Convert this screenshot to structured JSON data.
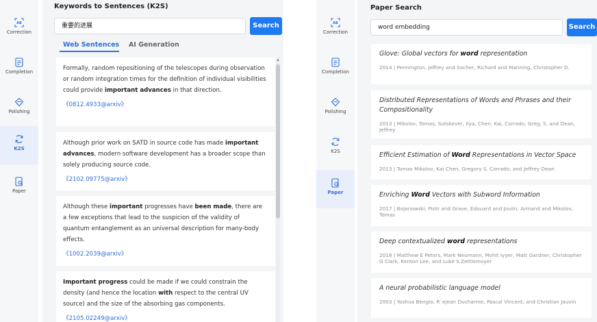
{
  "left_sidebar": {
    "items": [
      {
        "label": "Correction",
        "icon": "ab-correction-icon"
      },
      {
        "label": "Completion",
        "icon": "document-icon"
      },
      {
        "label": "Polishing",
        "icon": "diamond-icon"
      },
      {
        "label": "K2S",
        "icon": "refresh-icon"
      },
      {
        "label": "Paper",
        "icon": "paper-search-icon"
      }
    ],
    "active": "K2S"
  },
  "k2s": {
    "title": "Keywords to Sentences (K2S)",
    "search_value": "重要的进展",
    "search_button": "Search",
    "tabs": [
      "Web Sentences",
      "AI Generation"
    ],
    "active_tab": "Web Sentences",
    "results": [
      {
        "segments": [
          {
            "t": "Formally, random repositioning of the telescopes during observation or random integration times for the definition of individual visibilities could provide ",
            "b": false
          },
          {
            "t": "important advances",
            "b": true
          },
          {
            "t": " in that direction.",
            "b": false
          }
        ],
        "source": "《0812.4933@arxiv》"
      },
      {
        "segments": [
          {
            "t": "Although prior work on SATD in source code has made ",
            "b": false
          },
          {
            "t": "important advances",
            "b": true
          },
          {
            "t": ", modern software development has a broader scope than solely producing source code.",
            "b": false
          }
        ],
        "source": "《2102.09775@arxiv》"
      },
      {
        "segments": [
          {
            "t": "Although these ",
            "b": false
          },
          {
            "t": "important",
            "b": true
          },
          {
            "t": " progresses have ",
            "b": false
          },
          {
            "t": "been made",
            "b": true
          },
          {
            "t": ", there are a few exceptions that lead to the suspicion of the validity of quantum entanglement as an universal description for many-body effects.",
            "b": false
          }
        ],
        "source": "《1002.2039@arxiv》"
      },
      {
        "segments": [
          {
            "t": "Important progress",
            "b": true
          },
          {
            "t": " could be made if we could constrain the density (and hence the location ",
            "b": false
          },
          {
            "t": "with",
            "b": true
          },
          {
            "t": " respect to the central UV source) and the size of the absorbing gas components.",
            "b": false
          }
        ],
        "source": "《2105.02249@arxiv》"
      }
    ]
  },
  "right_sidebar": {
    "items": [
      {
        "label": "Correction",
        "icon": "ab-correction-icon"
      },
      {
        "label": "Completion",
        "icon": "document-icon"
      },
      {
        "label": "Polishing",
        "icon": "diamond-icon"
      },
      {
        "label": "K2S",
        "icon": "refresh-icon"
      },
      {
        "label": "Paper",
        "icon": "paper-search-icon"
      }
    ],
    "active": "Paper"
  },
  "paper_search": {
    "title": "Paper Search",
    "search_value": "word embedding",
    "search_button": "Search",
    "results": [
      {
        "title_segments": [
          {
            "t": "Glove: Global vectors for ",
            "b": false
          },
          {
            "t": "word",
            "b": true
          },
          {
            "t": " representation",
            "b": false
          }
        ],
        "meta": "2014 | Pennington, Jeffrey and Socher, Richard and Manning, Christopher D."
      },
      {
        "title_segments": [
          {
            "t": "Distributed Representations of Words and Phrases and their Compositionality",
            "b": false
          }
        ],
        "meta": "2013 | Mikolov, Tomas, Sutskever, Ilya, Chen, Kai, Corrado, Greg, S. and Dean, Jeffrey"
      },
      {
        "title_segments": [
          {
            "t": "Efficient Estimation of ",
            "b": false
          },
          {
            "t": "Word",
            "b": true
          },
          {
            "t": " Representations in Vector Space",
            "b": false
          }
        ],
        "meta": "2013 | Tomas Mikolov, Kai Chen, Gregory S. Corrado, and Jeffrey Dean"
      },
      {
        "title_segments": [
          {
            "t": "Enriching ",
            "b": false
          },
          {
            "t": "Word",
            "b": true
          },
          {
            "t": " Vectors with Subword Information",
            "b": false
          }
        ],
        "meta": "2017 | Bojanowski, Piotr and Grave, Edouard and Joulin, Armand and Mikolov, Tomas"
      },
      {
        "title_segments": [
          {
            "t": "Deep contextualized ",
            "b": false
          },
          {
            "t": "word",
            "b": true
          },
          {
            "t": " representations",
            "b": false
          }
        ],
        "meta": "2018 | Matthew E Peters, Mark Neumann, Mohit Iyyer, Matt Gardner, Christopher G Clark, Kenton Lee, and Luke S Zettlemoyer"
      },
      {
        "title_segments": [
          {
            "t": "A neural probabilistic language model",
            "b": false
          }
        ],
        "meta": "2003 | Yoshua Bengio, R´ejean Ducharme, Pascal Vincent, and Christian Jauvin"
      }
    ]
  },
  "colors": {
    "accent": "#1d7af0",
    "link": "#2f6ed8",
    "panel_bg": "#f4f5f7",
    "sidebar_bg": "#f6f7f9"
  }
}
